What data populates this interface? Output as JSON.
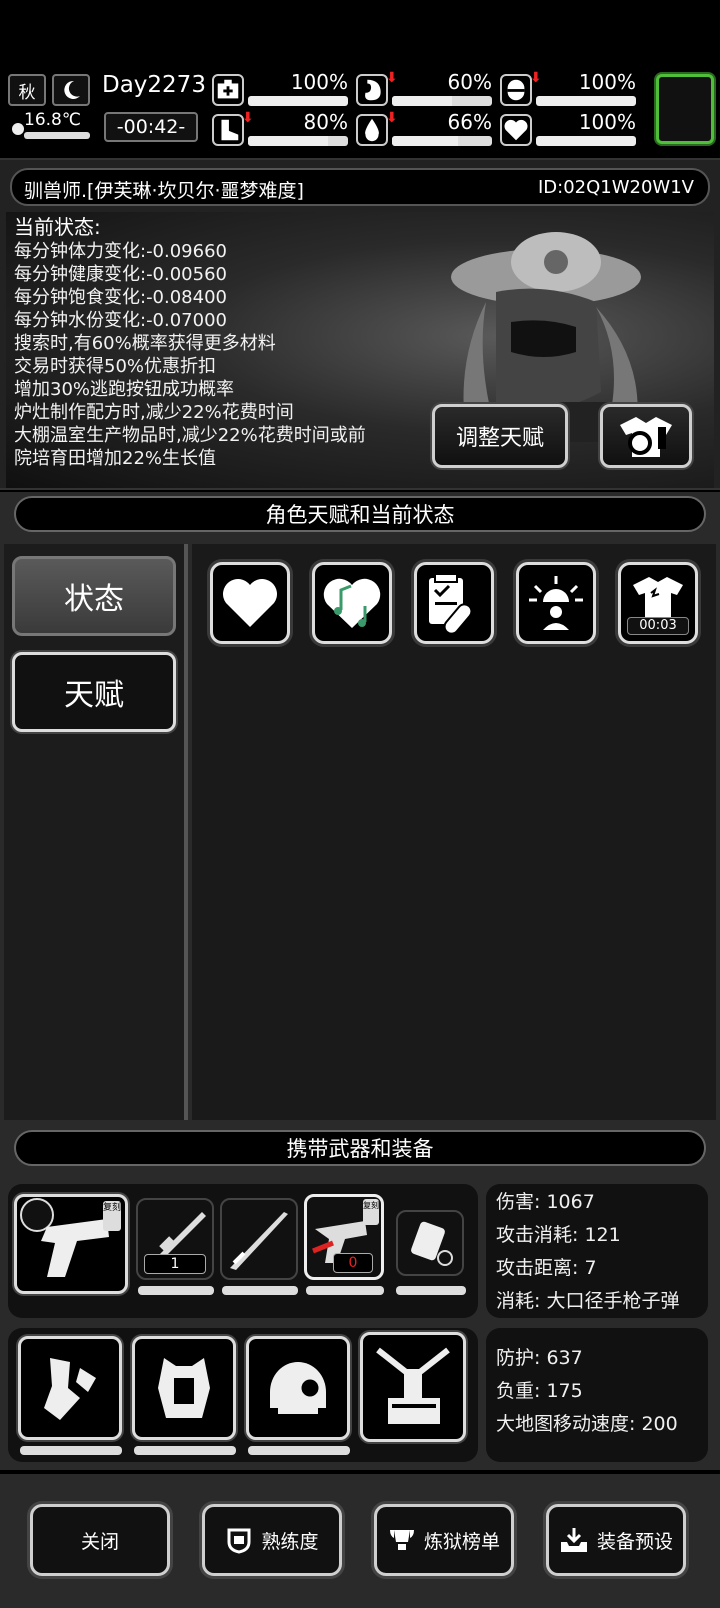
{
  "topbar": {
    "season": "秋",
    "temperature": "16.8℃",
    "day": "Day2273",
    "time": "-00:42-",
    "stats": [
      {
        "name": "medkit",
        "value": "100%",
        "fill": 1.0,
        "down": false
      },
      {
        "name": "stomach",
        "value": "60%",
        "fill": 0.6,
        "down": true
      },
      {
        "name": "pill",
        "value": "100%",
        "fill": 1.0,
        "down": true
      },
      {
        "name": "stamina-boot",
        "value": "80%",
        "fill": 0.8,
        "down": true
      },
      {
        "name": "water-drop",
        "value": "66%",
        "fill": 0.66,
        "down": true
      },
      {
        "name": "heart",
        "value": "100%",
        "fill": 1.0,
        "down": false
      }
    ]
  },
  "character": {
    "name": "驯兽师.[伊芙琳·坎贝尔·噩梦难度]",
    "id": "ID:02Q1W20W1V"
  },
  "status": {
    "heading": "当前状态:",
    "lines": [
      "每分钟体力变化:-0.09660",
      "每分钟健康变化:-0.00560",
      "每分钟饱食变化:-0.08400",
      "每分钟水份变化:-0.07000",
      "搜索时,有60%概率获得更多材料",
      "交易时获得50%优惠折扣",
      "增加30%逃跑按钮成功概率",
      "炉灶制作配方时,减少22%花费时间",
      "大棚温室生产物品时,减少22%花费时间或前",
      "院培育田增加22%生长值"
    ],
    "adjust_button": "调整天赋"
  },
  "talent_section": {
    "title": "角色天赋和当前状态",
    "tabs": [
      "状态",
      "天赋"
    ],
    "active_tab": "状态",
    "status_icons": [
      "heart-icon",
      "music-heart-icon",
      "clipboard-pill-icon",
      "alarm-person-icon",
      "shirt-timer-icon"
    ],
    "shirt_timer": "00:03"
  },
  "equipment_section": {
    "title": "携带武器和装备",
    "weapons": [
      {
        "name": "revolver",
        "badge": "复刻",
        "count": ""
      },
      {
        "name": "rifle",
        "badge": "",
        "count": "1"
      },
      {
        "name": "katana",
        "badge": "",
        "count": ""
      },
      {
        "name": "revolver-alt",
        "badge": "复刻",
        "count": "0"
      },
      {
        "name": "armor-pack",
        "badge": "",
        "count": ""
      }
    ],
    "weapon_stats": [
      "伤害: 1067",
      "攻击消耗: 121",
      "攻击距离: 7",
      "消耗: 大口径手枪子弹"
    ],
    "armor_stats": [
      "防护: 637",
      "负重: 175",
      "大地图移动速度: 200"
    ]
  },
  "bottom_buttons": [
    "关闭",
    "熟练度",
    "炼狱榜单",
    "装备预设"
  ]
}
